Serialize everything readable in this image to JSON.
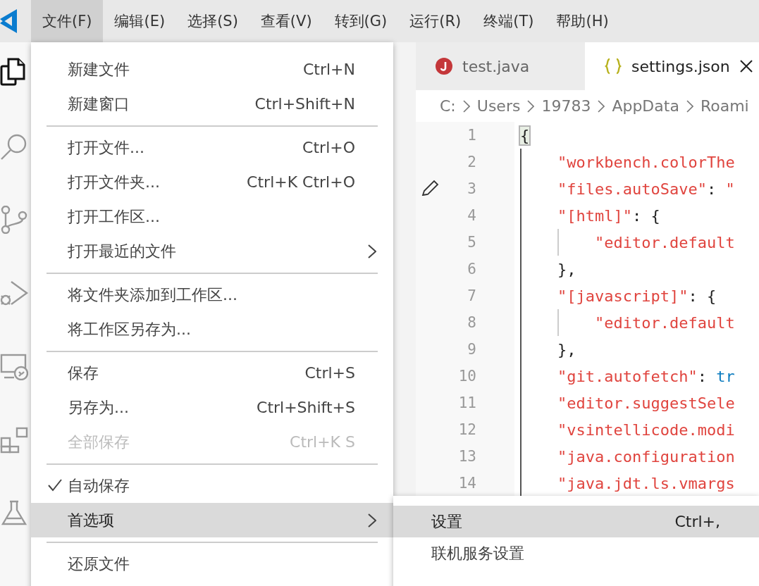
{
  "menubar": {
    "items": [
      {
        "label": "文件(F)",
        "selected": true
      },
      {
        "label": "编辑(E)",
        "selected": false
      },
      {
        "label": "选择(S)",
        "selected": false
      },
      {
        "label": "查看(V)",
        "selected": false
      },
      {
        "label": "转到(G)",
        "selected": false
      },
      {
        "label": "运行(R)",
        "selected": false
      },
      {
        "label": "终端(T)",
        "selected": false
      },
      {
        "label": "帮助(H)",
        "selected": false
      }
    ]
  },
  "tabs": [
    {
      "label": "test.java",
      "kind": "java",
      "selected": false
    },
    {
      "label": "settings.json",
      "kind": "json",
      "selected": true
    }
  ],
  "breadcrumb": [
    "C:",
    "Users",
    "19783",
    "AppData",
    "Roami"
  ],
  "editor": {
    "lines": [
      {
        "number": "1",
        "tokens": [
          {
            "kind": "punct",
            "text": "{"
          }
        ]
      },
      {
        "number": "2",
        "tokens": [
          {
            "kind": "key",
            "text": "    \"workbench.colorThe"
          }
        ]
      },
      {
        "number": "3",
        "tokens": [
          {
            "kind": "key",
            "text": "    \"files.autoSave\""
          },
          {
            "kind": "punct",
            "text": ": "
          },
          {
            "kind": "key",
            "text": "\""
          }
        ]
      },
      {
        "number": "4",
        "tokens": [
          {
            "kind": "key",
            "text": "    \"[html]\""
          },
          {
            "kind": "punct",
            "text": ": {"
          }
        ]
      },
      {
        "number": "5",
        "tokens": [
          {
            "kind": "key",
            "text": "        \"editor.default"
          }
        ]
      },
      {
        "number": "6",
        "tokens": [
          {
            "kind": "punct",
            "text": "    },"
          }
        ]
      },
      {
        "number": "7",
        "tokens": [
          {
            "kind": "key",
            "text": "    \"[javascript]\""
          },
          {
            "kind": "punct",
            "text": ": {"
          }
        ]
      },
      {
        "number": "8",
        "tokens": [
          {
            "kind": "key",
            "text": "        \"editor.default"
          }
        ]
      },
      {
        "number": "9",
        "tokens": [
          {
            "kind": "punct",
            "text": "    },"
          }
        ]
      },
      {
        "number": "10",
        "tokens": [
          {
            "kind": "key",
            "text": "    \"git.autofetch\""
          },
          {
            "kind": "punct",
            "text": ": "
          },
          {
            "kind": "value",
            "text": "tr"
          }
        ]
      },
      {
        "number": "11",
        "tokens": [
          {
            "kind": "key",
            "text": "    \"editor.suggestSele"
          }
        ]
      },
      {
        "number": "12",
        "tokens": [
          {
            "kind": "key",
            "text": "    \"vsintellicode.modi"
          }
        ]
      },
      {
        "number": "13",
        "tokens": [
          {
            "kind": "key",
            "text": "    \"java.configuration"
          }
        ]
      },
      {
        "number": "14",
        "tokens": [
          {
            "kind": "key",
            "text": "    \"java.jdt.ls.vmargs"
          }
        ]
      }
    ]
  },
  "file_menu": {
    "items": [
      {
        "kind": "item",
        "label": "新建文件",
        "shortcut": "Ctrl+N",
        "disabled": false,
        "checked": false,
        "selected": false,
        "submenu": false
      },
      {
        "kind": "item",
        "label": "新建窗口",
        "shortcut": "Ctrl+Shift+N",
        "disabled": false,
        "checked": false,
        "selected": false,
        "submenu": false
      },
      {
        "kind": "separator"
      },
      {
        "kind": "item",
        "label": "打开文件...",
        "shortcut": "Ctrl+O",
        "disabled": false,
        "checked": false,
        "selected": false,
        "submenu": false
      },
      {
        "kind": "item",
        "label": "打开文件夹...",
        "shortcut": "Ctrl+K Ctrl+O",
        "disabled": false,
        "checked": false,
        "selected": false,
        "submenu": false
      },
      {
        "kind": "item",
        "label": "打开工作区...",
        "disabled": false,
        "checked": false,
        "selected": false,
        "submenu": false
      },
      {
        "kind": "item",
        "label": "打开最近的文件",
        "disabled": false,
        "checked": false,
        "selected": false,
        "submenu": true
      },
      {
        "kind": "separator"
      },
      {
        "kind": "item",
        "label": "将文件夹添加到工作区...",
        "disabled": false,
        "checked": false,
        "selected": false,
        "submenu": false
      },
      {
        "kind": "item",
        "label": "将工作区另存为...",
        "disabled": false,
        "checked": false,
        "selected": false,
        "submenu": false
      },
      {
        "kind": "separator"
      },
      {
        "kind": "item",
        "label": "保存",
        "shortcut": "Ctrl+S",
        "disabled": false,
        "checked": false,
        "selected": false,
        "submenu": false
      },
      {
        "kind": "item",
        "label": "另存为...",
        "shortcut": "Ctrl+Shift+S",
        "disabled": false,
        "checked": false,
        "selected": false,
        "submenu": false
      },
      {
        "kind": "item",
        "label": "全部保存",
        "shortcut": "Ctrl+K S",
        "disabled": true,
        "checked": false,
        "selected": false,
        "submenu": false
      },
      {
        "kind": "separator"
      },
      {
        "kind": "item",
        "label": "自动保存",
        "disabled": false,
        "checked": true,
        "selected": false,
        "submenu": false
      },
      {
        "kind": "item",
        "label": "首选项",
        "disabled": false,
        "checked": false,
        "selected": true,
        "submenu": true
      },
      {
        "kind": "separator"
      },
      {
        "kind": "item",
        "label": "还原文件",
        "disabled": false,
        "checked": false,
        "selected": false,
        "submenu": false
      }
    ]
  },
  "preferences_submenu": {
    "items": [
      {
        "label": "设置",
        "shortcut": "Ctrl+,",
        "selected": true
      },
      {
        "label": "联机服务设置",
        "selected": false
      }
    ]
  }
}
